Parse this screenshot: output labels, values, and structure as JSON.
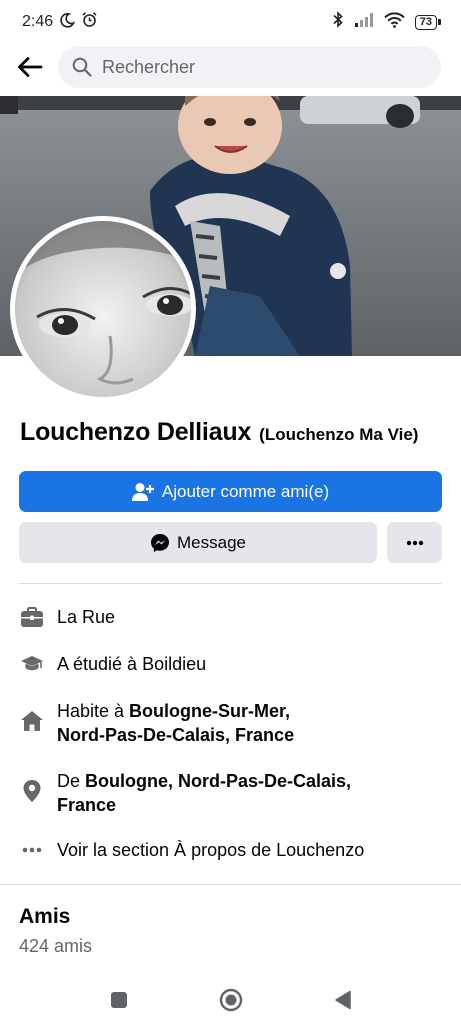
{
  "status_bar": {
    "time": "2:46",
    "battery": "73"
  },
  "search": {
    "placeholder": "Rechercher"
  },
  "profile": {
    "name": "Louchenzo Delliaux",
    "alternate_name": "(Louchenzo Ma Vie)"
  },
  "actions": {
    "add_friend_label": "Ajouter comme ami(e)",
    "message_label": "Message"
  },
  "details": {
    "work": "La Rue",
    "education": "A étudié à Boildieu",
    "lives_prefix": "Habite à ",
    "lives_place_line1": "Boulogne-Sur-Mer,",
    "lives_place_line2": "Nord-Pas-De-Calais, France",
    "from_prefix": "De ",
    "from_place_line1": "Boulogne, Nord-Pas-De-Calais,",
    "from_place_line2": "France",
    "see_about": "Voir la section À propos de Louchenzo"
  },
  "friends": {
    "title": "Amis",
    "count": "424 amis"
  },
  "colors": {
    "primary": "#1b74e4",
    "secondary_bg": "#e4e6eb",
    "muted_text": "#65676b"
  },
  "icons": {
    "status": [
      "moon-icon",
      "alarm-icon",
      "bluetooth-icon",
      "signal-icon",
      "wifi-icon",
      "battery-icon"
    ],
    "details": [
      "briefcase-icon",
      "graduation-cap-icon",
      "home-icon",
      "location-pin-icon",
      "more-dots-icon"
    ],
    "nav": [
      "recent-apps-icon",
      "home-circle-icon",
      "back-triangle-icon"
    ]
  }
}
